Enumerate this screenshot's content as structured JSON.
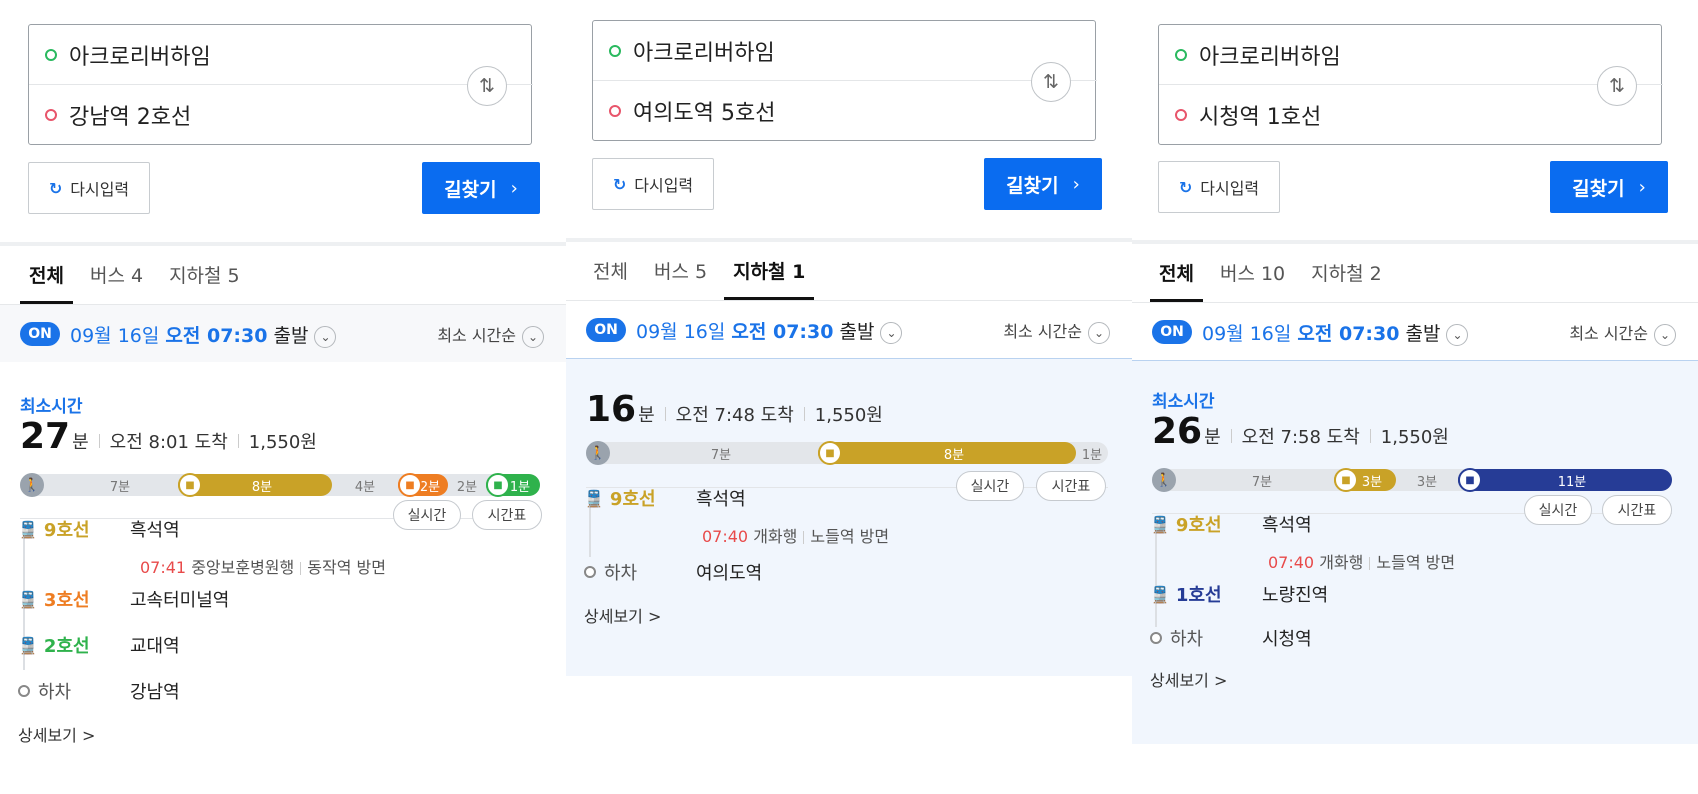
{
  "common": {
    "reset_label": "다시입력",
    "reset_icon": "refresh-icon",
    "search_label": "길찾기",
    "swap_icon": "swap-vertical-icon",
    "on_badge": "ON",
    "date": "09월 16일",
    "time": "오전 07:30",
    "depart": "출발",
    "sort": "최소 시간순",
    "realtime": "실시간",
    "timetable": "시간표",
    "detail": "상세보기 >",
    "alight": "하차",
    "fastest_label": "최소시간",
    "minute_unit": "분",
    "colors": {
      "line9": "#c9a227",
      "line3": "#ee7d22",
      "line2": "#2fb24c",
      "line1": "#263c96",
      "line5": "#8b50c7",
      "accent": "#1a73e8"
    }
  },
  "panels": [
    {
      "origin": "아크로리버하임",
      "destination": "강남역 2호선",
      "tabs": [
        {
          "label": "전체",
          "active": true
        },
        {
          "label": "버스 4",
          "active": false
        },
        {
          "label": "지하철 5",
          "active": false
        }
      ],
      "summary": {
        "minutes": "27",
        "arrival": "오전 8:01 도착",
        "fare": "1,550원"
      },
      "bar": {
        "walk1": "7분",
        "seg1": "8분",
        "walk2": "4분",
        "seg2": "2분",
        "walk3": "2분",
        "seg3": "1분"
      },
      "steps": [
        {
          "line": "9호선",
          "station": "흑석역",
          "time": "07:41",
          "dest": "중앙보훈병원행",
          "direction": "동작역 방면"
        },
        {
          "line": "3호선",
          "station": "고속터미널역"
        },
        {
          "line": "2호선",
          "station": "교대역"
        },
        {
          "line": "하차",
          "station": "강남역"
        }
      ]
    },
    {
      "origin": "아크로리버하임",
      "destination": "여의도역 5호선",
      "tabs": [
        {
          "label": "전체",
          "active": false
        },
        {
          "label": "버스 5",
          "active": false
        },
        {
          "label": "지하철 1",
          "active": true
        }
      ],
      "summary": {
        "minutes": "16",
        "arrival": "오전 7:48 도착",
        "fare": "1,550원"
      },
      "bar": {
        "walk1": "7분",
        "seg1": "8분",
        "walk2": "1분"
      },
      "steps": [
        {
          "line": "9호선",
          "station": "흑석역",
          "time": "07:40",
          "dest": "개화행",
          "direction": "노들역 방면"
        },
        {
          "line": "하차",
          "station": "여의도역"
        }
      ]
    },
    {
      "origin": "아크로리버하임",
      "destination": "시청역 1호선",
      "tabs": [
        {
          "label": "전체",
          "active": true
        },
        {
          "label": "버스 10",
          "active": false
        },
        {
          "label": "지하철 2",
          "active": false
        }
      ],
      "summary": {
        "minutes": "26",
        "arrival": "오전 7:58 도착",
        "fare": "1,550원"
      },
      "bar": {
        "walk1": "7분",
        "seg1": "3분",
        "walk2": "3분",
        "seg2": "11분"
      },
      "steps": [
        {
          "line": "9호선",
          "station": "흑석역",
          "time": "07:40",
          "dest": "개화행",
          "direction": "노들역 방면"
        },
        {
          "line": "1호선",
          "station": "노량진역"
        },
        {
          "line": "하차",
          "station": "시청역"
        }
      ]
    }
  ]
}
